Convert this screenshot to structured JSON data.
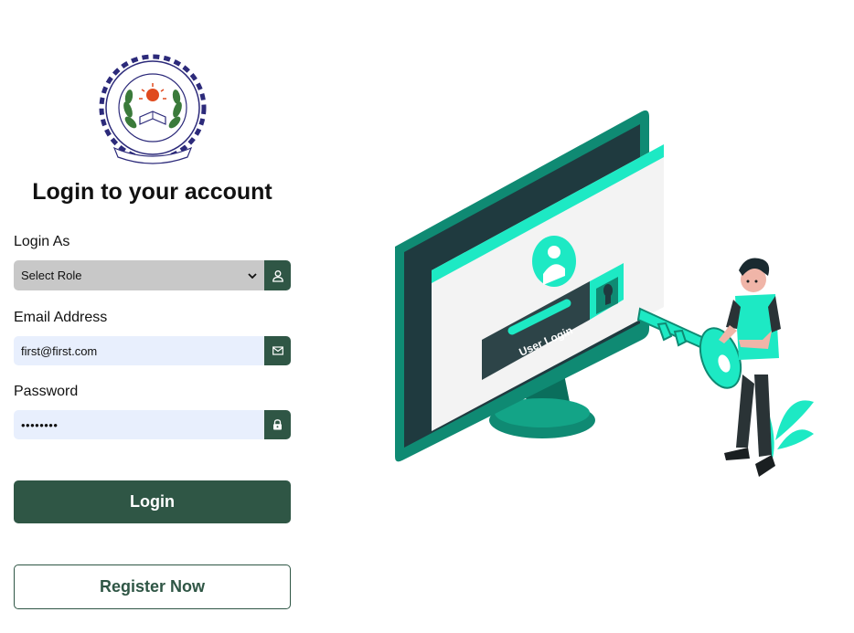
{
  "logo": {
    "ring_text": "राष्ट्रीय प्रौद्योगिकी संस्थान अगरतला",
    "inner_text": "NATIONAL INSTITUTE OF TECHNOLOGY AGARTALA",
    "motto": "सत्यमेव परम धर्मः"
  },
  "heading": "Login to your account",
  "role": {
    "label": "Login As",
    "selected": "Select Role",
    "icon": "user-icon"
  },
  "email": {
    "label": "Email Address",
    "value": "first@first.com",
    "icon": "mail-icon"
  },
  "password": {
    "label": "Password",
    "value": "••••••••",
    "icon": "lock-icon"
  },
  "login_button": "Login",
  "register_button": "Register Now",
  "illustration": {
    "screen_label": "User Login"
  },
  "colors": {
    "primary": "#2f5645",
    "input_bg": "#e8effd",
    "select_bg": "#c8c8c8",
    "accent": "#1de9c4",
    "monitor": "#0f8a73"
  }
}
